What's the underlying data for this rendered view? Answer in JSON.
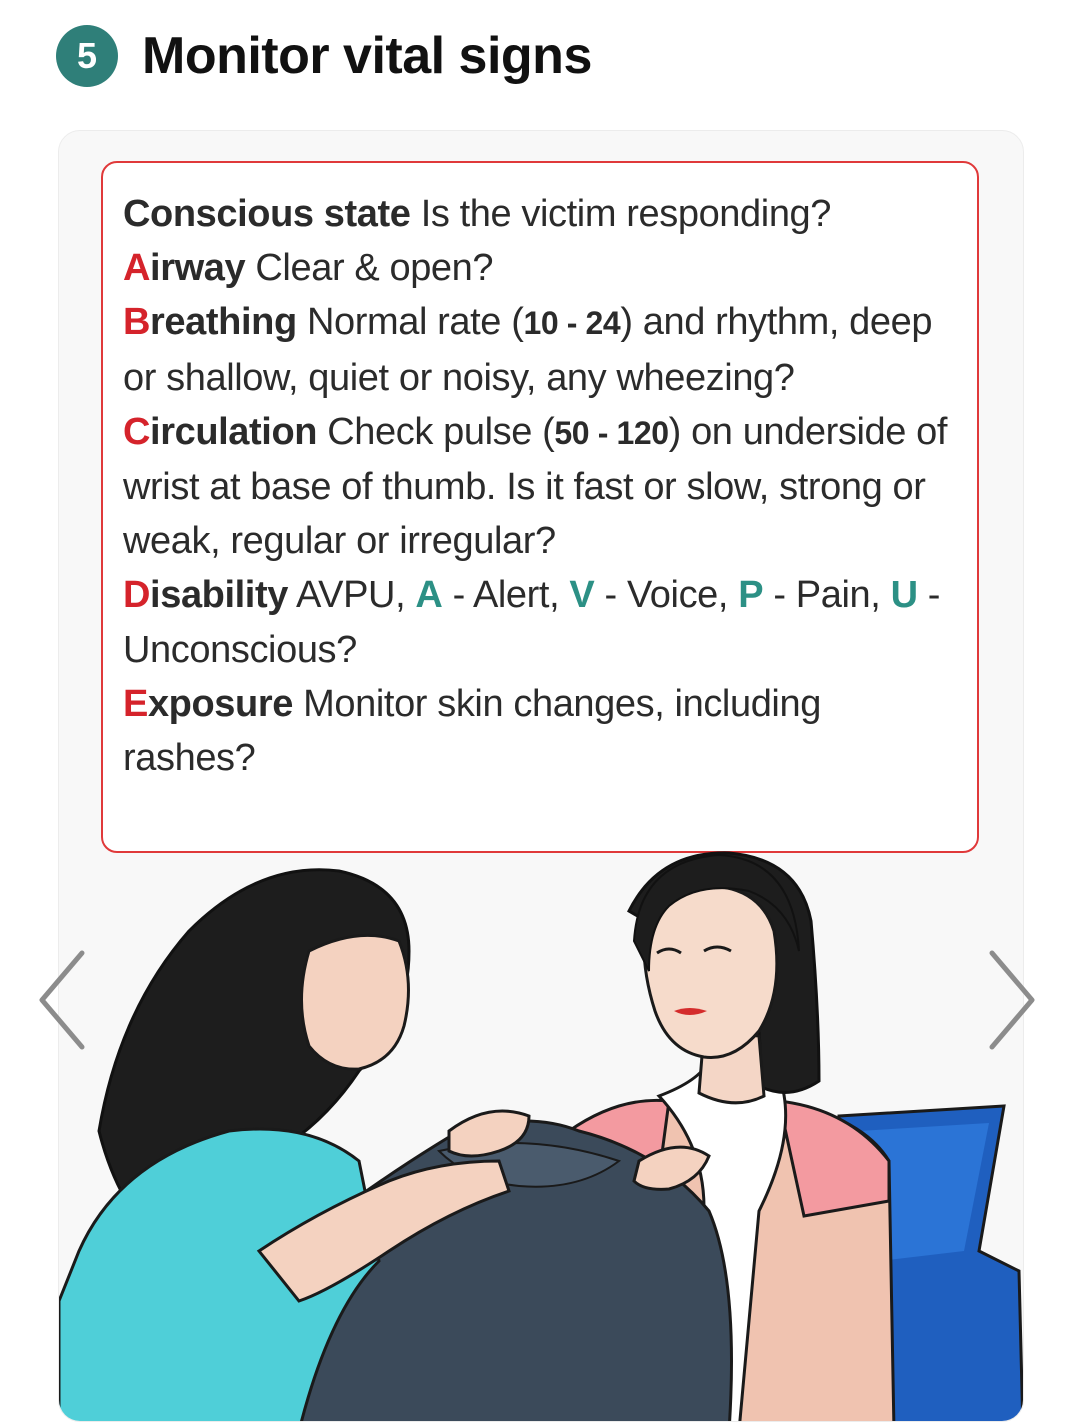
{
  "step": {
    "number": "5",
    "title": "Monitor vital signs"
  },
  "vitals": {
    "conscious": {
      "term": "Conscious state",
      "text": "Is the victim responding?"
    },
    "airway": {
      "initial": "A",
      "rest": "irway",
      "text": "Clear & open?"
    },
    "breathing": {
      "initial": "B",
      "rest": "reathing",
      "text_before": "Normal rate",
      "range_open": "(",
      "range": "10 - 24",
      "range_close": ")",
      "text_after": "and rhythm, deep or shallow, quiet or noisy, any wheezing?"
    },
    "circulation": {
      "initial": "C",
      "rest": "irculation",
      "text_before": "Check pulse",
      "range_open": "(",
      "range": "50 - 120",
      "range_close": ")",
      "text_after": "on underside of wrist at base of thumb. Is it fast or slow, strong or weak, regular or irregular?"
    },
    "disability": {
      "initial": "D",
      "rest": "isability",
      "lead": "AVPU,",
      "a_letter": "A",
      "a_text": "- Alert,",
      "v_letter": "V",
      "v_text": "- Voice,",
      "p_letter": "P",
      "p_text": "- Pain,",
      "u_letter": "U",
      "u_text": "- Unconscious?"
    },
    "exposure": {
      "initial": "E",
      "rest": "xposure",
      "text": "Monitor skin changes, including rashes?"
    }
  },
  "navigation": {
    "prev_icon": "chevron-left-icon",
    "next_icon": "chevron-right-icon"
  },
  "colors": {
    "badge": "#2f7f79",
    "accent_red": "#d5232b",
    "accent_teal": "#2c9085",
    "border_red": "#e0393a"
  }
}
